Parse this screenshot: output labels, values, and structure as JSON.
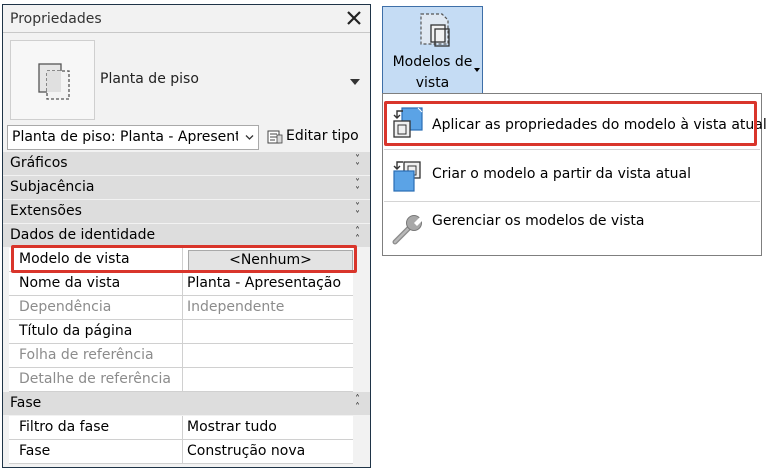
{
  "properties_panel": {
    "title": "Propriedades",
    "type_name": "Planta de piso",
    "instance_selector": "Planta de piso: Planta - Apresenta",
    "edit_type_label": "Editar tipo",
    "groups": {
      "graficos": "Gráficos",
      "subjacencia": "Subjacência",
      "extensoes": "Extensões",
      "dados_identidade": "Dados de identidade",
      "fase": "Fase"
    },
    "identity_rows": [
      {
        "label": "Modelo de vista",
        "value": "<Nenhum>"
      },
      {
        "label": "Nome da vista",
        "value": "Planta - Apresentação"
      },
      {
        "label": "Dependência",
        "value": "Independente"
      },
      {
        "label": "Título da página",
        "value": ""
      },
      {
        "label": "Folha de referência",
        "value": ""
      },
      {
        "label": "Detalhe de referência",
        "value": ""
      }
    ],
    "phase_rows": [
      {
        "label": "Filtro da fase",
        "value": "Mostrar tudo"
      },
      {
        "label": "Fase",
        "value": "Construção nova"
      }
    ]
  },
  "ribbon_button": {
    "line1": "Modelos de",
    "line2": "vista",
    "icon": "view-template-icon"
  },
  "dropdown_menu": {
    "items": [
      {
        "label": "Aplicar as propriedades do modelo à vista atual",
        "icon": "apply-template-icon"
      },
      {
        "label": "Criar o modelo a partir da vista atual",
        "icon": "create-template-icon"
      },
      {
        "label": "Gerenciar os modelos de vista",
        "icon": "wrench-icon"
      }
    ]
  },
  "colors": {
    "highlight": "#d9352b",
    "ribbon_active": "#c5dcf4",
    "group_header": "#dddddd"
  }
}
